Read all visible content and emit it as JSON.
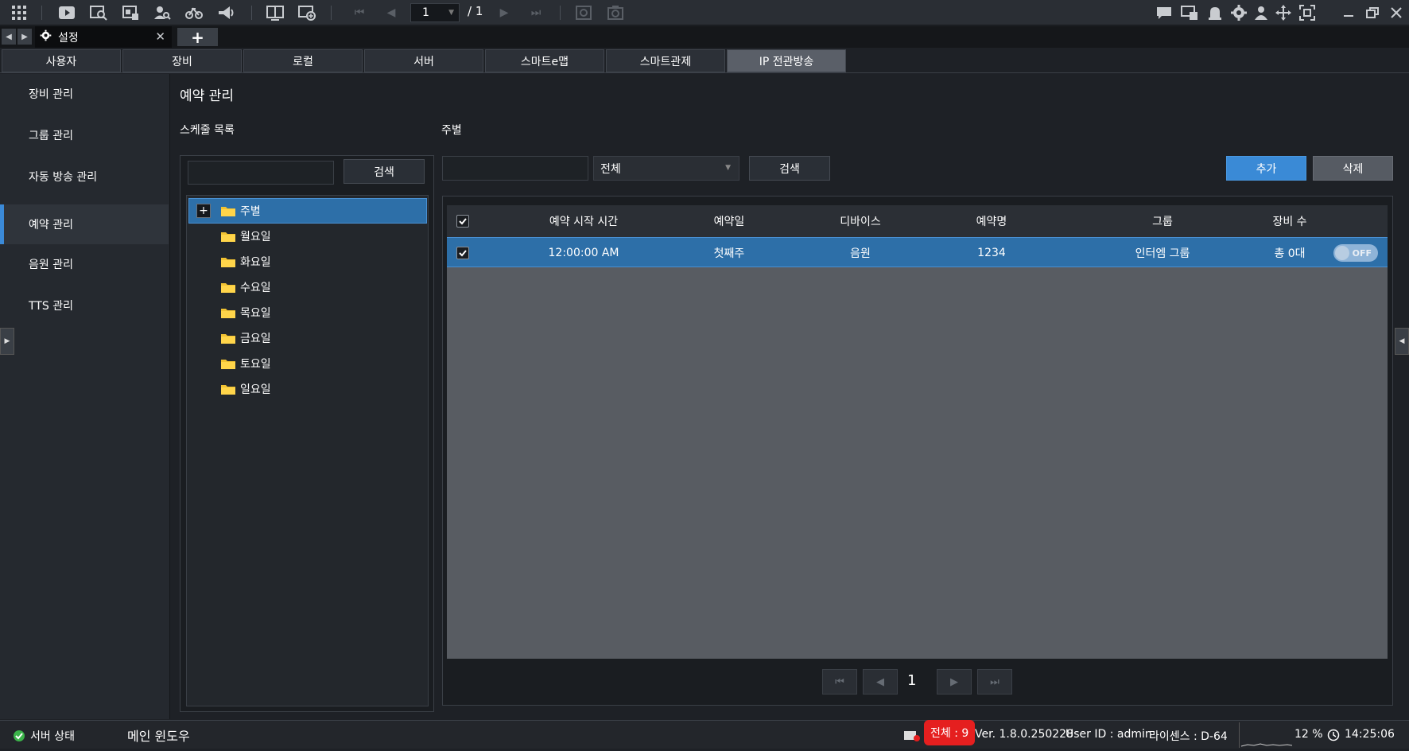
{
  "toolbar": {
    "page_current": "1",
    "page_total": "/ 1",
    "left_icons": [
      "grid-icon",
      "play-icon",
      "search-video-icon",
      "export-icon",
      "person-search-icon",
      "bicycle-icon",
      "megaphone-icon",
      "split-screen-icon",
      "add-screen-icon"
    ],
    "right_icons": [
      "chat-icon",
      "monitor-alert-icon",
      "alert-icon",
      "gear-icon",
      "user-icon",
      "move-icon",
      "fullscreen-icon",
      "minimize-icon",
      "restore-icon",
      "close-icon"
    ]
  },
  "tabstrip": {
    "settings_label": "설정"
  },
  "main_tabs": [
    {
      "label": "사용자"
    },
    {
      "label": "장비"
    },
    {
      "label": "로컬"
    },
    {
      "label": "서버"
    },
    {
      "label": "스마트e맵"
    },
    {
      "label": "스마트관제"
    },
    {
      "label": "IP 전관방송"
    }
  ],
  "sidebar": {
    "items": [
      {
        "label": "장비 관리"
      },
      {
        "label": "그룹 관리"
      },
      {
        "label": "자동 방송 관리"
      },
      {
        "label": "예약 관리"
      },
      {
        "label": "음원 관리"
      },
      {
        "label": "TTS 관리"
      }
    ]
  },
  "content": {
    "title": "예약 관리",
    "schedule_list_label": "스케줄 목록",
    "weekly_label": "주별",
    "search_button": "검색",
    "filter_value": "전체",
    "add_button": "추가",
    "delete_button": "삭제"
  },
  "tree": {
    "root": "주별",
    "children": [
      "월요일",
      "화요일",
      "수요일",
      "목요일",
      "금요일",
      "토요일",
      "일요일"
    ]
  },
  "table": {
    "headers": [
      "예약 시작 시간",
      "예약일",
      "디바이스",
      "예약명",
      "그룹",
      "장비 수"
    ],
    "rows": [
      {
        "start": "12:00:00 AM",
        "day": "첫째주",
        "device": "음원",
        "name": "1234",
        "group": "인터엠 그룹",
        "count": "총 0대",
        "toggle": "OFF"
      }
    ]
  },
  "pagination": {
    "page": "1"
  },
  "status": {
    "server_status": "서버 상태",
    "main_window": "메인 윈도우",
    "alarm": "전체 : 9",
    "version": "Ver. 1.8.0.250228",
    "user": "User ID : admin",
    "license": "라이센스 : D-64",
    "cpu": "12 %",
    "time": "14:25:06"
  },
  "colors": {
    "accent": "#3a8ad6",
    "selection": "#2d6fa8",
    "alarm": "#e51f1f",
    "background": "#1e2126"
  }
}
